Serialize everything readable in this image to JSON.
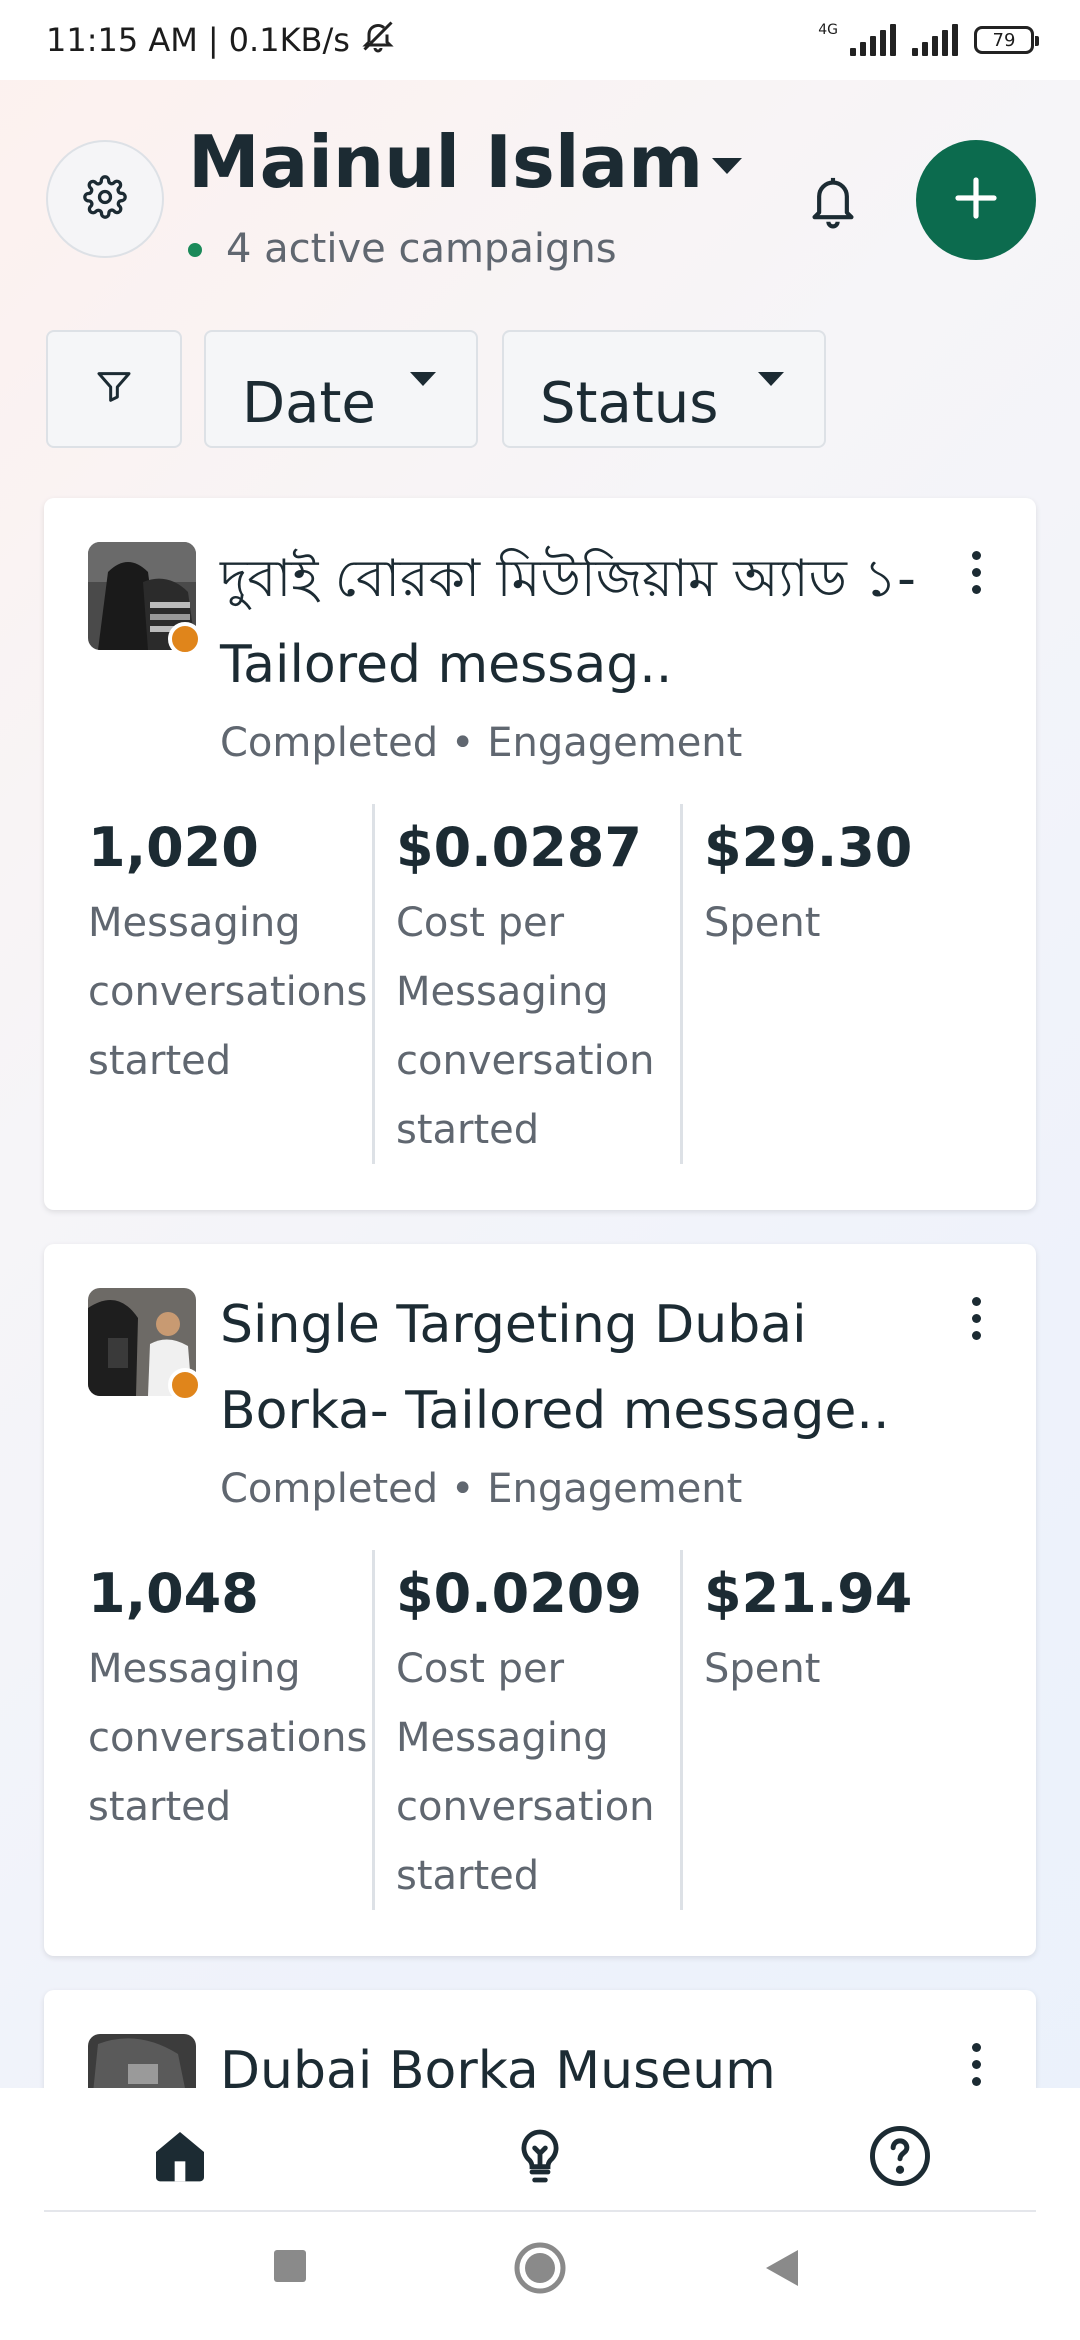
{
  "status_bar": {
    "time": "11:15 AM",
    "separator": "|",
    "speed": "0.1KB/s",
    "network": "4G",
    "battery": "79"
  },
  "header": {
    "account_name": "Mainul Islam",
    "active_campaigns": "4 active campaigns",
    "settings_icon": "gear-icon",
    "notifications_icon": "bell-icon",
    "create_icon": "plus-icon",
    "accent_color": "#0c6b4e"
  },
  "filters": {
    "filter_icon": "funnel-icon",
    "date_label": "Date",
    "status_label": "Status"
  },
  "campaigns": [
    {
      "title": "দুবাই বোরকা মিউজিয়াম অ্যাড ১-  Tailored messag..",
      "status": "Completed",
      "objective": "Engagement",
      "results_value": "1,020",
      "results_label": "Messaging conversations started",
      "cost_value": "$0.0287",
      "cost_label": "Cost per Messaging conversation started",
      "spent_value": "$29.30",
      "spent_label": "Spent"
    },
    {
      "title": "Single Targeting Dubai Borka- Tailored message..",
      "status": "Completed",
      "objective": "Engagement",
      "results_value": "1,048",
      "results_label": "Messaging conversations started",
      "cost_value": "$0.0209",
      "cost_label": "Cost per Messaging conversation started",
      "spent_value": "$21.94",
      "spent_label": "Spent"
    },
    {
      "title": "Dubai Borka Museum"
    }
  ],
  "status_dot_color": "#e0851b",
  "bottom_nav": {
    "items": [
      "home-icon",
      "lightbulb-icon",
      "help-icon"
    ]
  },
  "system_nav": [
    "recents-button",
    "home-button",
    "back-button"
  ]
}
